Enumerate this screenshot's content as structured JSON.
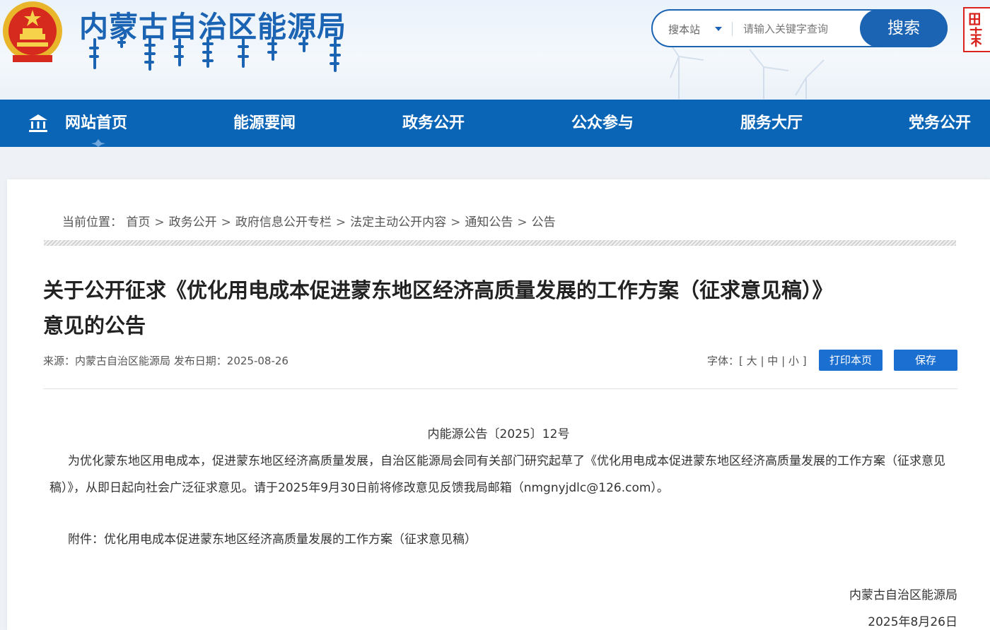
{
  "header": {
    "site_title": "内蒙古自治区能源局",
    "search": {
      "scope": "搜本站",
      "placeholder": "请输入关键字查询",
      "button": "搜索"
    }
  },
  "nav": {
    "items": [
      "网站首页",
      "能源要闻",
      "政务公开",
      "公众参与",
      "服务大厅",
      "党务公开"
    ]
  },
  "breadcrumb": {
    "prefix": "当前位置：",
    "items": [
      "首页",
      "政务公开",
      "政府信息公开专栏",
      "法定主动公开内容",
      "通知公告",
      "公告"
    ],
    "separator": ">"
  },
  "article": {
    "title_line1": "关于公开征求《优化用电成本促进蒙东地区经济高质量发展的工作方案（征求意见稿）》",
    "title_line2": "意见的公告",
    "meta": "来源：内蒙古自治区能源局 发布日期：2025-08-26",
    "font_size": {
      "label": "字体：[",
      "large": "大",
      "medium": "中",
      "small": "小",
      "close": "]",
      "divider": "|"
    },
    "print_button": "打印本页",
    "save_button": "保存",
    "doc_number": "内能源公告〔2025〕12号",
    "body": "为优化蒙东地区用电成本，促进蒙东地区经济高质量发展，自治区能源局会同有关部门研究起草了《优化用电成本促进蒙东地区经济高质量发展的工作方案（征求意见稿）》，从即日起向社会广泛征求意见。请于2025年9月30日前将修改意见反馈我局邮箱（nmgnyjdlc@126.com）。",
    "attachment": "附件：优化用电成本促进蒙东地区经济高质量发展的工作方案（征求意见稿）",
    "signature_org": "内蒙古自治区能源局",
    "signature_date": "2025年8月26日"
  },
  "colors": {
    "primary": "#1b63b3",
    "nav_bg": "#0b65b6",
    "seal_red": "#d9231f"
  }
}
